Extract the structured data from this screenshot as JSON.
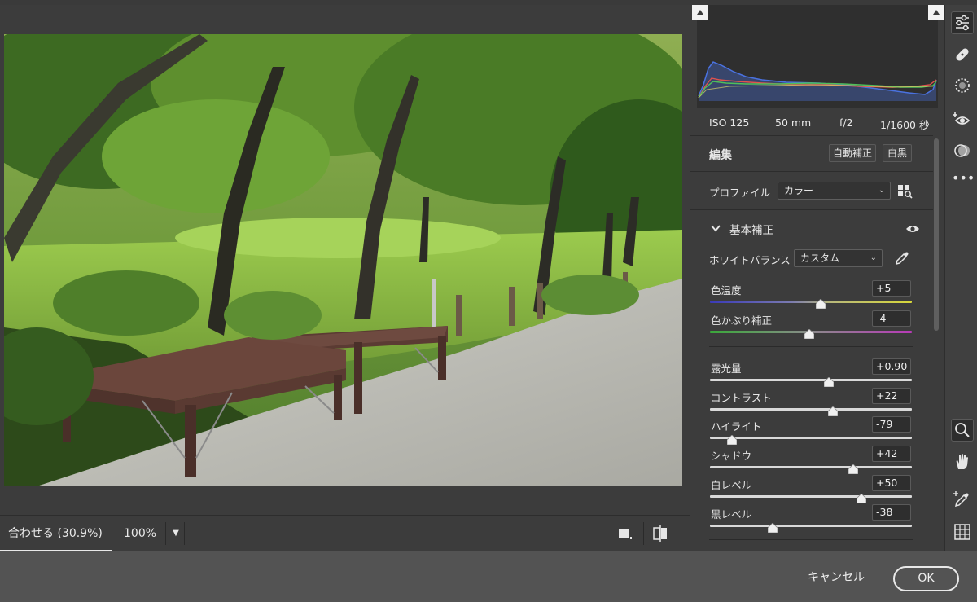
{
  "canvas": {
    "zoom_fit_label": "合わせる (30.9%)",
    "zoom_100_label": "100%",
    "zoom_dropdown_icon": "chevron-down-icon",
    "view_single_icon": "single-view-icon",
    "view_compare_icon": "before-after-icon"
  },
  "histogram": {
    "shadow_clip_icon": "clipping-warning-icon",
    "highlight_clip_icon": "clipping-warning-icon",
    "colors": {
      "red": "#e0524e",
      "green": "#4fbf5a",
      "blue": "#4a72e0"
    }
  },
  "metadata": {
    "iso": "ISO 125",
    "focal": "50 mm",
    "aperture": "f/2",
    "shutter": "1/1600 秒"
  },
  "edit": {
    "title": "編集",
    "auto_label": "自動補正",
    "bw_label": "白黒",
    "profile_label": "プロファイル",
    "profile_value": "カラー",
    "profile_browser_icon": "grid-search-icon"
  },
  "basic": {
    "title": "基本補正",
    "expand_icon": "chevron-down-icon",
    "visibility_icon": "eye-icon",
    "wb_label": "ホワイトバランス",
    "wb_value": "カスタム",
    "wb_picker_icon": "eyedropper-icon",
    "sliders": [
      {
        "label": "色温度",
        "value": "+5",
        "pos": 0.55
      },
      {
        "label": "色かぶり補正",
        "value": "-4",
        "pos": 0.49
      },
      {
        "label": "露光量",
        "value": "+0.90",
        "pos": 0.59
      },
      {
        "label": "コントラスト",
        "value": "+22",
        "pos": 0.61
      },
      {
        "label": "ハイライト",
        "value": "-79",
        "pos": 0.11
      },
      {
        "label": "シャドウ",
        "value": "+42",
        "pos": 0.71
      },
      {
        "label": "白レベル",
        "value": "+50",
        "pos": 0.75
      },
      {
        "label": "黒レベル",
        "value": "-38",
        "pos": 0.31
      }
    ]
  },
  "tools": [
    "sliders-icon",
    "healing-bandage-icon",
    "mask-icon",
    "red-eye-icon",
    "presets-icon",
    "more-icon",
    "zoom-icon",
    "hand-icon",
    "color-sampler-icon",
    "grid-icon"
  ],
  "footer": {
    "cancel_label": "キャンセル",
    "ok_label": "OK"
  }
}
